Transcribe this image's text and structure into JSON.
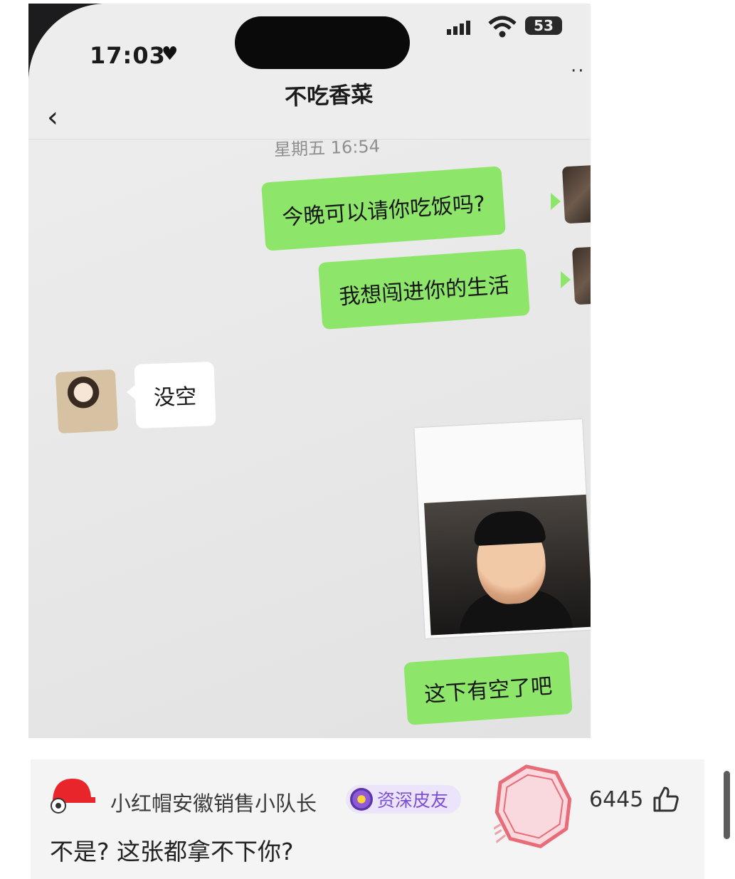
{
  "status_bar": {
    "time": "17:03",
    "battery": "53"
  },
  "chat": {
    "title": "不吃香菜",
    "timestamp": "星期五 16:54",
    "messages": [
      {
        "from": "me",
        "text": "今晚可以请你吃饭吗?"
      },
      {
        "from": "me",
        "text": "我想闯进你的生活"
      },
      {
        "from": "her",
        "text": "没空"
      },
      {
        "from": "me",
        "type": "image"
      },
      {
        "from": "me",
        "text": "这下有空了吧"
      }
    ]
  },
  "comment": {
    "username": "小红帽安徽销售小队长",
    "badge": "资深皮友",
    "likes": "6445",
    "text": "不是? 这张都拿不下你?"
  },
  "colors": {
    "bubble_green": "#8de56a",
    "badge_purple": "#7c4fd4",
    "seal_red": "#e86b78"
  }
}
